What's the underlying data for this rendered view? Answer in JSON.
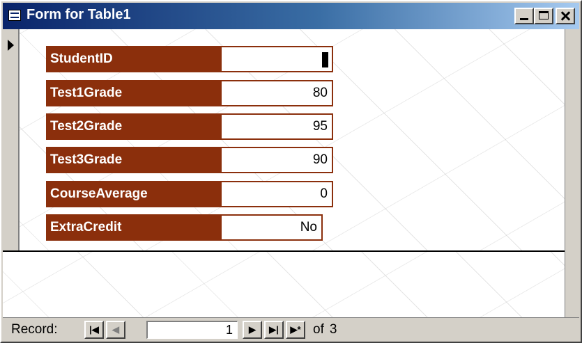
{
  "window": {
    "title": "Form for Table1",
    "icon": "form-icon",
    "controls": [
      "minimize-icon",
      "maximize-icon",
      "close-icon"
    ]
  },
  "form": {
    "fields": [
      {
        "label": "StudentID",
        "value": "",
        "has_caret": true
      },
      {
        "label": "Test1Grade",
        "value": "80"
      },
      {
        "label": "Test2Grade",
        "value": "95"
      },
      {
        "label": "Test3Grade",
        "value": "90"
      },
      {
        "label": "CourseAverage",
        "value": "0"
      },
      {
        "label": "ExtraCredit",
        "value": "No"
      }
    ]
  },
  "navigation": {
    "record_label": "Record:",
    "first_icon": "|◀",
    "prev_icon": "◀",
    "current_record": "1",
    "next_icon": "▶",
    "last_icon": "▶|",
    "new_icon": "▶*",
    "of_label": "of",
    "total_records": "3"
  },
  "colors": {
    "label_background": "#8b2f0c",
    "title_bar": "#0a246a",
    "window_face": "#d4d0c8"
  }
}
